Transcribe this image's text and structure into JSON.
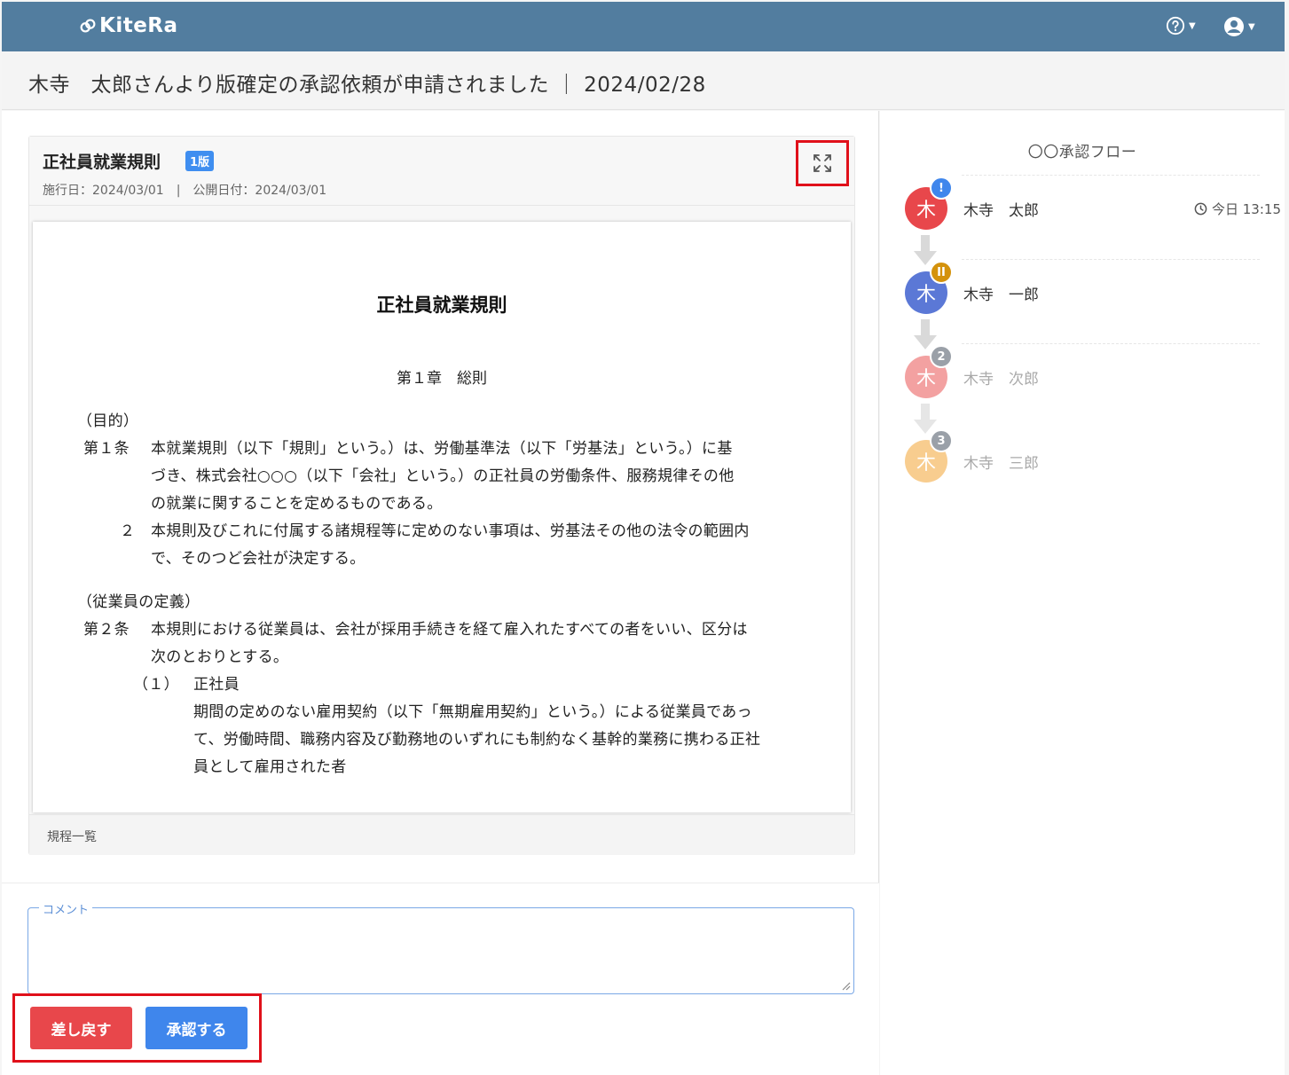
{
  "app": {
    "logo": "KiteRa"
  },
  "header": {
    "help_icon": "question-circle-icon",
    "user_icon": "user-circle-icon"
  },
  "titlebar": {
    "title": "木寺　太郎さんより版確定の承認依頼が申請されました ｜ 2024/02/28"
  },
  "document": {
    "title": "正社員就業規則",
    "version_badge": "1版",
    "meta": "施行日：2024/03/01　|　公開日付：2024/03/01",
    "expand_icon": "expand-icon",
    "content": {
      "title": "正社員就業規則",
      "chapter": "第１章　総則",
      "lines": [
        "（目的）",
        "第１条",
        "本就業規則（以下「規則」という。）は、労働基準法（以下「労基法」という。）に基",
        "づき、株式会社○○○（以下「会社」という。）の正社員の労働条件、服務規律その他",
        "の就業に関することを定めるものである。",
        "２",
        "本規則及びこれに付属する諸規程等に定めのない事項は、労基法その他の法令の範囲内",
        "で、そのつど会社が決定する。",
        "（従業員の定義）",
        "第２条",
        "本規則における従業員は、会社が採用手続きを経て雇入れたすべての者をいい、区分は",
        "次のとおりとする。",
        "（１）",
        "正社員",
        "期間の定めのない雇用契約（以下「無期雇用契約」という。）による従業員であっ",
        "て、労働時間、職務内容及び勤務地のいずれにも制約なく基幹的業務に携わる正社",
        "員として雇用された者"
      ]
    },
    "footer_link": "規程一覧"
  },
  "comment": {
    "label": "コメント",
    "value": ""
  },
  "actions": {
    "reject_label": "差し戻す",
    "approve_label": "承認する"
  },
  "flow": {
    "title": "〇〇承認フロー",
    "steps": [
      {
        "avatar": "木",
        "name": "木寺　太郎",
        "badge": "!",
        "status": "requested",
        "time": "今日 13:15",
        "color": "#e8474b",
        "badge_color": "#3f86ec"
      },
      {
        "avatar": "木",
        "name": "木寺　一郎",
        "badge": "II",
        "status": "pending",
        "time": "",
        "color": "#5b78d6",
        "badge_color": "#d4920c"
      },
      {
        "avatar": "木",
        "name": "木寺　次郎",
        "badge": "2",
        "status": "waiting",
        "time": "",
        "color": "#f3a1a1",
        "badge_color": "#9aa0a8"
      },
      {
        "avatar": "木",
        "name": "木寺　三郎",
        "badge": "3",
        "status": "waiting",
        "time": "",
        "color": "#f8cd8f",
        "badge_color": "#9aa0a8"
      }
    ]
  }
}
